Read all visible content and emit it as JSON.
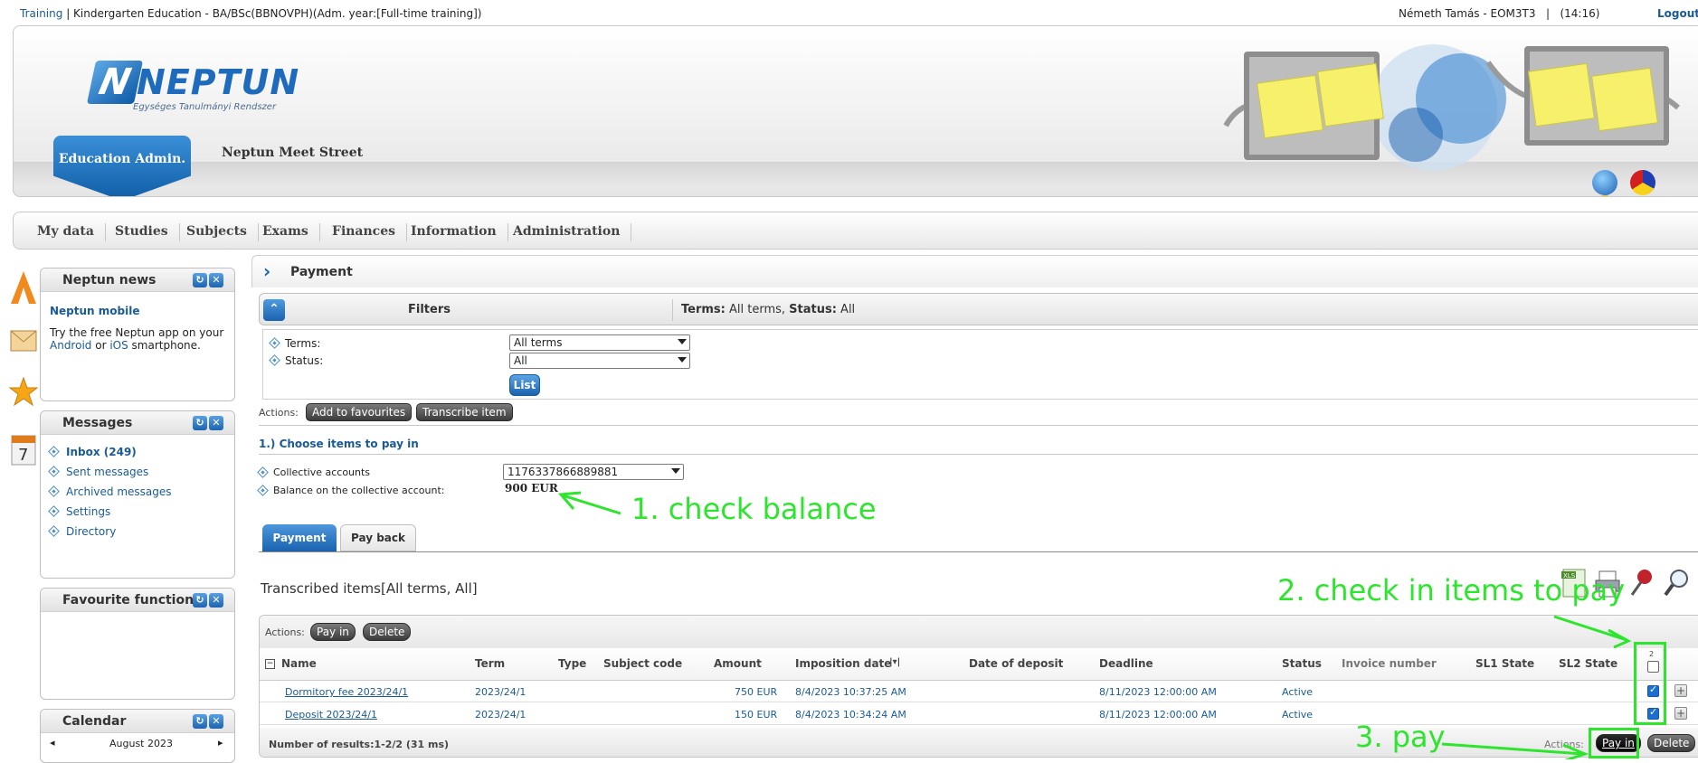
{
  "topbar": {
    "training": "Training",
    "program": "Kindergarten Education - BA/BSc(BBNOVPH)(Adm. year:[Full-time training])",
    "user": "Németh Tamás - EOM3T3",
    "time": "(14:16)",
    "logout": "Logout"
  },
  "header": {
    "logo_word": "NEPTUN",
    "logo_sub": "Egységes Tanulmányi Rendszer",
    "edu_tab": "Education Admin.",
    "meet_street": "Neptun Meet Street"
  },
  "menu": [
    "My data",
    "Studies",
    "Subjects",
    "Exams",
    "Finances",
    "Information",
    "Administration"
  ],
  "widgets": {
    "news": {
      "title": "Neptun news",
      "headline": "Neptun mobile",
      "text1": "Try the free Neptun app on your",
      "android": "Android",
      "or": " or ",
      "ios": "iOS",
      "text2": " smartphone."
    },
    "messages": {
      "title": "Messages",
      "items": [
        "Inbox (249)",
        "Sent messages",
        "Archived messages",
        "Settings",
        "Directory"
      ]
    },
    "favourites": {
      "title": "Favourite functions"
    },
    "calendar": {
      "title": "Calendar",
      "month": "August 2023"
    }
  },
  "main": {
    "title": "Payment",
    "filters": {
      "label": "Filters",
      "summary_terms_label": "Terms:",
      "summary_terms_value": " All terms, ",
      "summary_status_label": "Status:",
      "summary_status_value": " All",
      "terms_label": "Terms:",
      "terms_value": "All terms",
      "status_label": "Status:",
      "status_value": "All",
      "list_button": "List"
    },
    "actions_label": "Actions:",
    "add_favourites": "Add to favourites",
    "transcribe_item": "Transcribe item",
    "section_title": "1.) Choose items to pay in",
    "collective_accounts_label": "Collective accounts",
    "collective_accounts_value": "1176337866889881",
    "balance_label": "Balance on the collective account:",
    "balance_value": "900 EUR",
    "tabs": {
      "payment": "Payment",
      "pay_back": "Pay back"
    },
    "grid_title": "Transcribed items[All terms, All]",
    "grid_actions_label": "Actions:",
    "pay_in": "Pay in",
    "delete": "Delete",
    "columns": [
      "Name",
      "Term",
      "Type",
      "Subject code",
      "Amount",
      "Imposition date",
      "Date of deposit",
      "Deadline",
      "Status",
      "Invoice number",
      "SL1 State",
      "SL2 State"
    ],
    "select_count": "2",
    "rows": [
      {
        "name": "Dormitory fee 2023/24/1",
        "term": "2023/24/1",
        "type": "",
        "subject_code": "",
        "amount": "750 EUR",
        "imposition_date": "8/4/2023 10:37:25 AM",
        "date_of_deposit": "",
        "deadline": "8/11/2023 12:00:00 AM",
        "status": "Active",
        "checked": true
      },
      {
        "name": "Deposit 2023/24/1",
        "term": "2023/24/1",
        "type": "",
        "subject_code": "",
        "amount": "150 EUR",
        "imposition_date": "8/4/2023 10:34:24 AM",
        "date_of_deposit": "",
        "deadline": "8/11/2023 12:00:00 AM",
        "status": "Active",
        "checked": true
      }
    ],
    "result_count": "Number of results:1-2/2 (31 ms)",
    "footer_actions_label": "Actions:"
  },
  "annotations": {
    "a1": "1. check balance",
    "a2": "2. check in items to pay",
    "a3": "3. pay"
  },
  "colors": {
    "accent_blue": "#1a62ae",
    "annotation_green": "#2ee52e"
  },
  "icons": [
    "calendar-icon",
    "letter-icon",
    "star-icon",
    "calendar-7-icon",
    "globe-icon",
    "xls-icon",
    "printer-icon",
    "pin-icon",
    "magnifier-icon"
  ]
}
